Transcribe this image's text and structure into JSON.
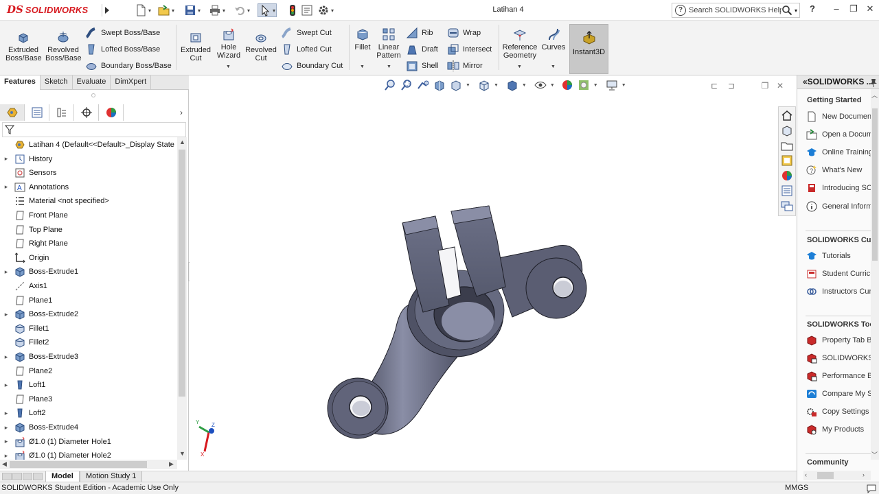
{
  "app": {
    "brand_ds": "DS",
    "brand_name": "SOLIDWORKS",
    "document_title": "Latihan 4"
  },
  "help_search": {
    "placeholder": "Search SOLIDWORKS Help"
  },
  "window_controls": [
    "?",
    "–",
    "❐",
    "✕"
  ],
  "command_manager": {
    "extruded_boss": "Extruded Boss/Base",
    "revolved_boss": "Revolved Boss/Base",
    "swept_boss": "Swept Boss/Base",
    "lofted_boss": "Lofted Boss/Base",
    "boundary_boss": "Boundary Boss/Base",
    "extruded_cut": "Extruded Cut",
    "hole_wizard": "Hole Wizard",
    "revolved_cut": "Revolved Cut",
    "swept_cut": "Swept Cut",
    "lofted_cut": "Lofted Cut",
    "boundary_cut": "Boundary Cut",
    "fillet": "Fillet",
    "linear_pattern": "Linear Pattern",
    "rib": "Rib",
    "draft": "Draft",
    "shell": "Shell",
    "wrap": "Wrap",
    "intersect": "Intersect",
    "mirror": "Mirror",
    "reference_geometry": "Reference Geometry",
    "curves": "Curves",
    "instant3d": "Instant3D"
  },
  "cm_tabs": [
    "Features",
    "Sketch",
    "Evaluate",
    "DimXpert"
  ],
  "feature_tree": [
    {
      "label": "Latihan 4  (Default<<Default>_Display State",
      "icon": "part-icon",
      "expand": ""
    },
    {
      "label": "History",
      "icon": "history-icon",
      "expand": "▸"
    },
    {
      "label": "Sensors",
      "icon": "sensors-icon",
      "expand": ""
    },
    {
      "label": "Annotations",
      "icon": "annotations-icon",
      "expand": "▸"
    },
    {
      "label": "Material <not specified>",
      "icon": "material-icon",
      "expand": ""
    },
    {
      "label": "Front Plane",
      "icon": "plane-icon",
      "expand": ""
    },
    {
      "label": "Top Plane",
      "icon": "plane-icon",
      "expand": ""
    },
    {
      "label": "Right Plane",
      "icon": "plane-icon",
      "expand": ""
    },
    {
      "label": "Origin",
      "icon": "origin-icon",
      "expand": ""
    },
    {
      "label": "Boss-Extrude1",
      "icon": "extrude-icon",
      "expand": "▸"
    },
    {
      "label": "Axis1",
      "icon": "axis-icon",
      "expand": ""
    },
    {
      "label": "Plane1",
      "icon": "plane-icon",
      "expand": ""
    },
    {
      "label": "Boss-Extrude2",
      "icon": "extrude-icon",
      "expand": "▸"
    },
    {
      "label": "Fillet1",
      "icon": "fillet-icon",
      "expand": ""
    },
    {
      "label": "Fillet2",
      "icon": "fillet-icon",
      "expand": ""
    },
    {
      "label": "Boss-Extrude3",
      "icon": "extrude-icon",
      "expand": "▸"
    },
    {
      "label": "Plane2",
      "icon": "plane-icon",
      "expand": ""
    },
    {
      "label": "Loft1",
      "icon": "loft-icon",
      "expand": "▸"
    },
    {
      "label": "Plane3",
      "icon": "plane-icon",
      "expand": ""
    },
    {
      "label": "Loft2",
      "icon": "loft-icon",
      "expand": "▸"
    },
    {
      "label": "Boss-Extrude4",
      "icon": "extrude-icon",
      "expand": "▸"
    },
    {
      "label": "Ø1.0 (1) Diameter Hole1",
      "icon": "hole-icon",
      "expand": "▸"
    },
    {
      "label": "Ø1.0 (1) Diameter Hole2",
      "icon": "hole-icon",
      "expand": "▸"
    }
  ],
  "bottom_tabs": [
    "Model",
    "Motion Study 1"
  ],
  "status": {
    "edition": "SOLIDWORKS Student Edition - Academic Use Only",
    "units": "MMGS"
  },
  "triad": {
    "x": "X",
    "y": "Y",
    "z": "Z"
  },
  "task_pane": {
    "header": "«SOLIDWORKS ...",
    "getting_started": "Getting Started",
    "getting_started_items": [
      "New Document",
      "Open a Document",
      "Online Training",
      "What's New",
      "Introducing SOLIDWORKS",
      "General Information"
    ],
    "curriculum": "SOLIDWORKS Curriculum",
    "curriculum_items": [
      "Tutorials",
      "Student Curriculum",
      "Instructors Curriculum"
    ],
    "tools": "SOLIDWORKS Tools",
    "tools_items": [
      "Property Tab Builder",
      "SOLIDWORKS Rx",
      "Performance Benchmark",
      "Compare My Score",
      "Copy Settings Wizard",
      "My Products"
    ],
    "community": "Community"
  },
  "colors": {
    "accent": "#d7191f",
    "part": "#5d6075",
    "part_light": "#8488a0",
    "part_dark": "#2b2d3a"
  }
}
